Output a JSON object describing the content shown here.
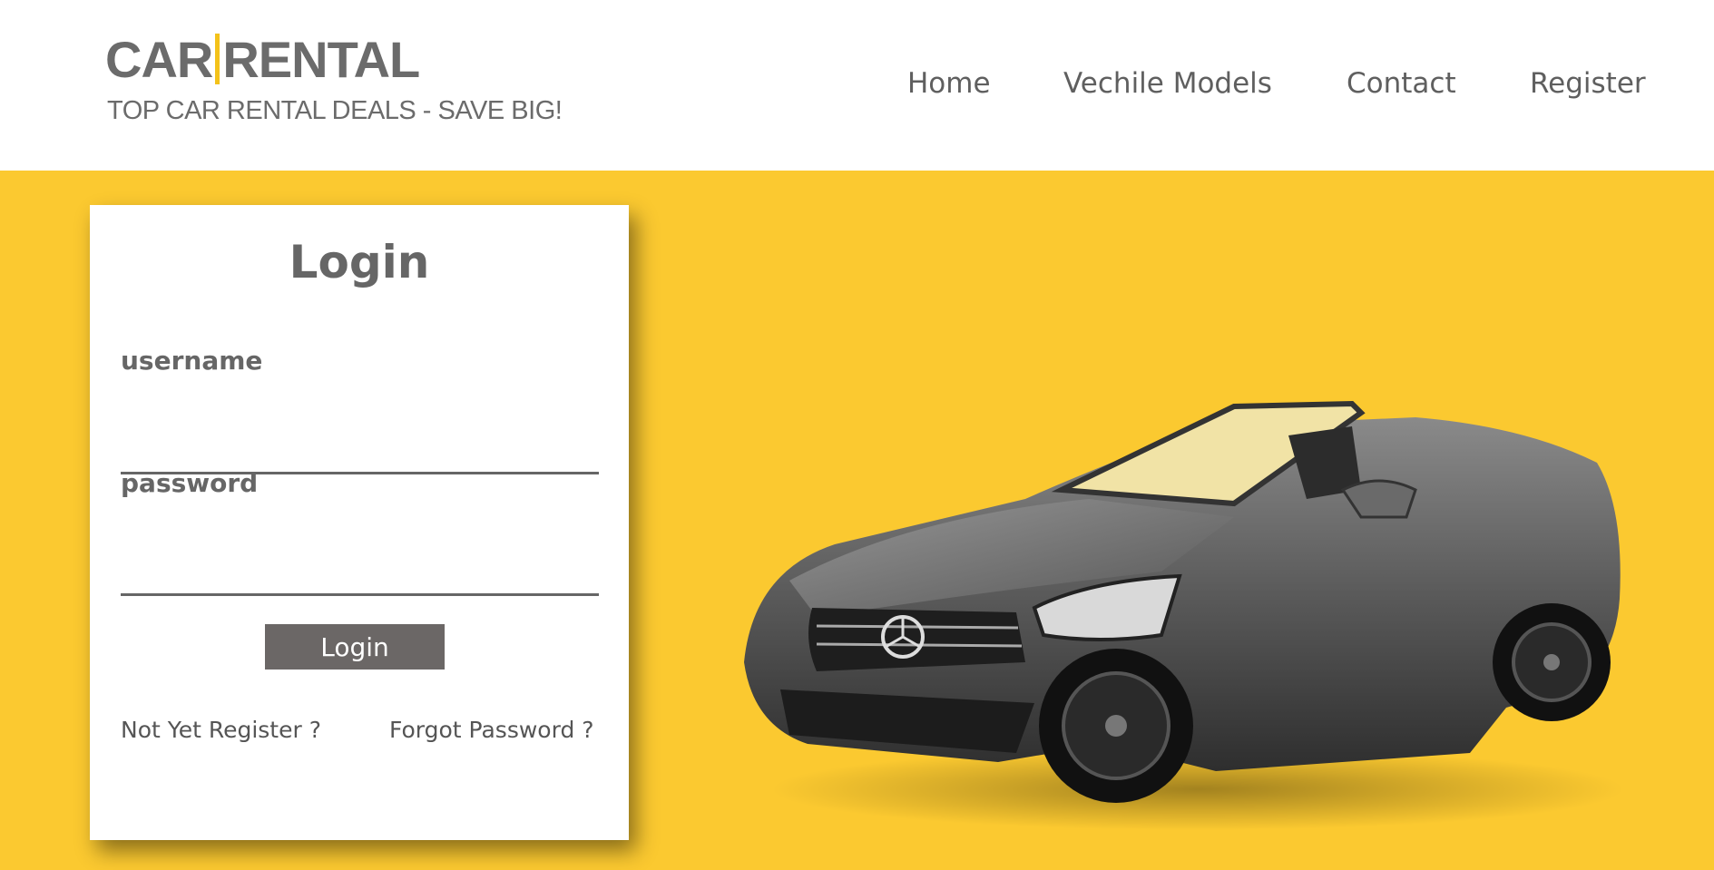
{
  "logo": {
    "main_left": "CAR",
    "main_right": "RENTAL",
    "tagline": "TOP CAR RENTAL DEALS - SAVE BIG!"
  },
  "nav": {
    "items": [
      {
        "label": "Home"
      },
      {
        "label": "Vechile Models"
      },
      {
        "label": "Contact"
      },
      {
        "label": "Register"
      }
    ]
  },
  "login": {
    "title": "Login",
    "username_label": "username",
    "username_value": "",
    "password_label": "password",
    "password_value": "",
    "button_label": "Login",
    "register_link": "Not Yet Register ?",
    "forgot_link": "Forgot Password ?"
  },
  "colors": {
    "hero_background": "#fbc930",
    "logo_accent": "#f4c21a",
    "button_background": "#6b6766",
    "text_gray": "#666666"
  },
  "hero": {
    "image": "gray-convertible-sports-car"
  }
}
